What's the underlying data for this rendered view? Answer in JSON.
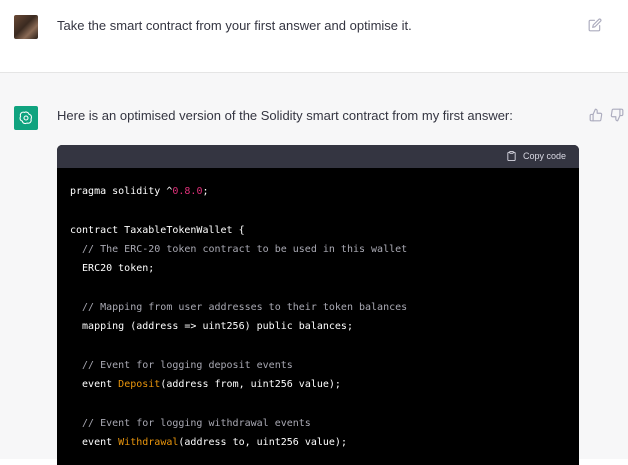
{
  "conversation": {
    "user_message": "Take the smart contract from your first answer and optimise it.",
    "assistant_message": "Here is an optimised version of the Solidity smart contract from my first answer:"
  },
  "icons": {
    "user_avatar": "user-avatar",
    "assistant_avatar": "openai-logo-icon",
    "edit": "edit-icon",
    "thumbs_up": "thumbs-up-icon",
    "thumbs_down": "thumbs-down-icon",
    "copy": "clipboard-icon"
  },
  "code": {
    "copy_label": "Copy code",
    "lines": [
      {
        "pre": "pragma solidity ^",
        "hl": "0.8.0",
        "post": ";"
      },
      {
        "pre": "",
        "hl": "",
        "post": ""
      },
      {
        "pre": "contract TaxableTokenWallet {",
        "hl": "",
        "post": ""
      },
      {
        "comment": "  // The ERC-20 token contract to be used in this wallet"
      },
      {
        "pre": "  ERC20 token;",
        "hl": "",
        "post": ""
      },
      {
        "pre": "",
        "hl": "",
        "post": ""
      },
      {
        "comment": "  // Mapping from user addresses to their token balances"
      },
      {
        "pre": "  mapping (address => uint256) public balances;",
        "hl": "",
        "post": ""
      },
      {
        "pre": "",
        "hl": "",
        "post": ""
      },
      {
        "comment": "  // Event for logging deposit events"
      },
      {
        "pre": "  event ",
        "hl2": "Deposit",
        "post": "(address from, uint256 value);"
      },
      {
        "pre": "",
        "hl": "",
        "post": ""
      },
      {
        "comment": "  // Event for logging withdrawal events"
      },
      {
        "pre": "  event ",
        "hl2": "Withdrawal",
        "post": "(address to, uint256 value);"
      }
    ]
  },
  "colors": {
    "accent_green": "#10a37f",
    "number_highlight": "#df3079",
    "identifier_highlight": "#e9950c",
    "comment": "#a9a9b3"
  }
}
